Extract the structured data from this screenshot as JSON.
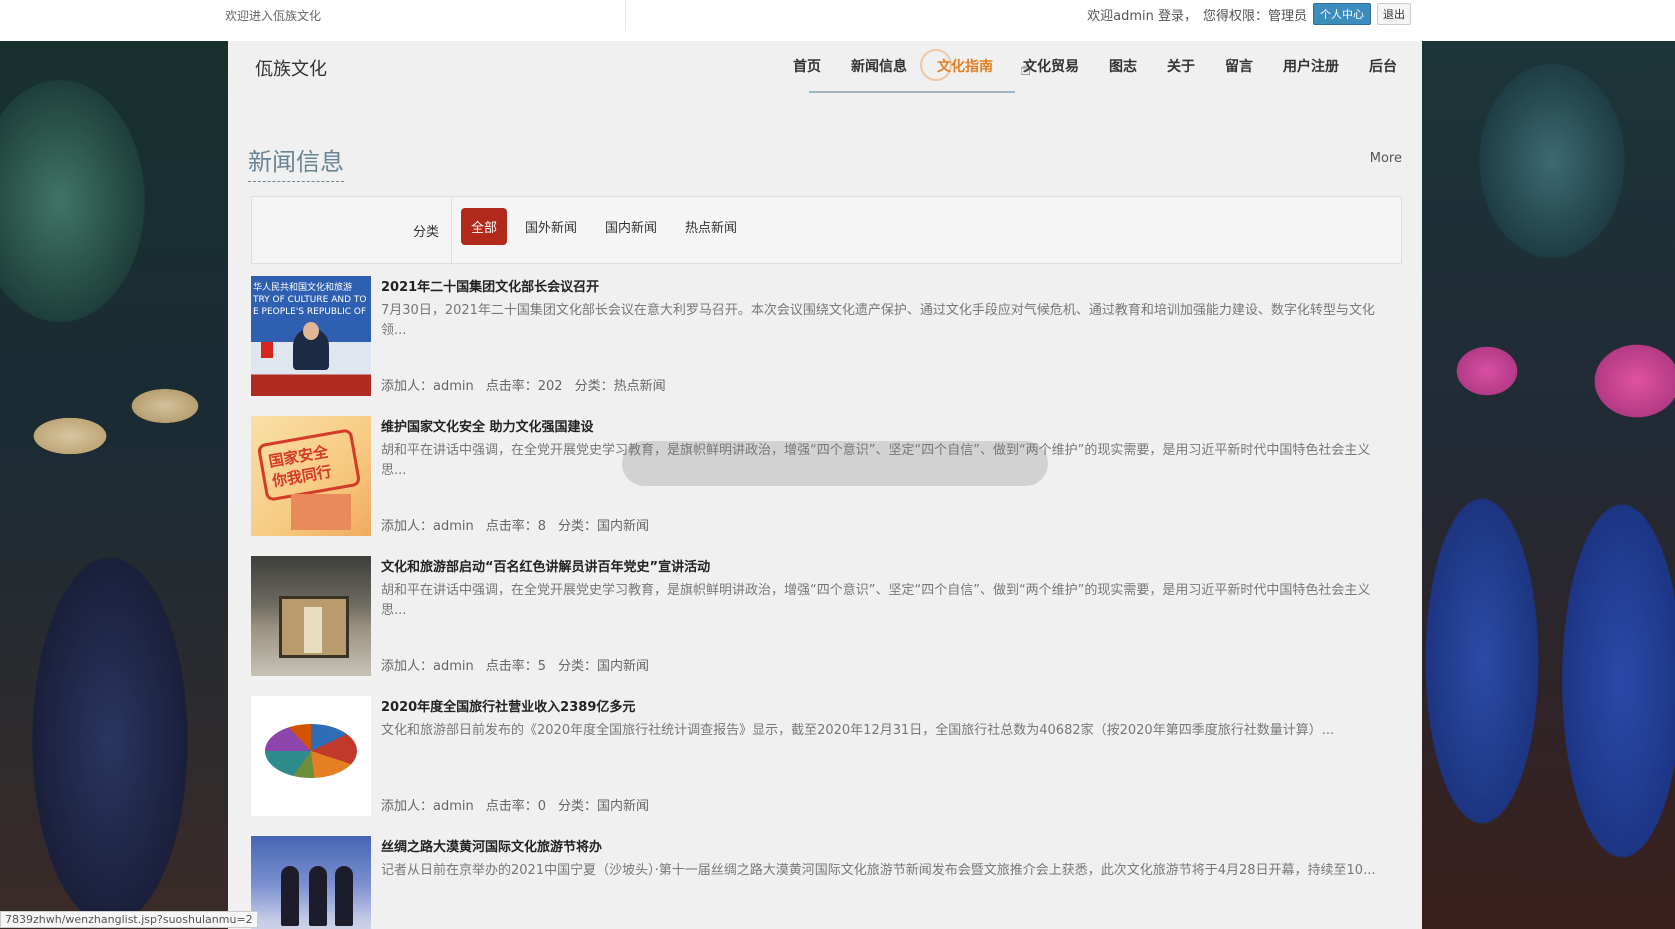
{
  "topbar": {
    "welcome": "欢迎进入佤族文化",
    "user_text": "欢迎admin 登录，",
    "role_text": "您得权限：管理员",
    "center_button": "个人中心",
    "logout_button": "退出"
  },
  "header": {
    "logo": "佤族文化",
    "nav": [
      {
        "label": "首页"
      },
      {
        "label": "新闻信息"
      },
      {
        "label": "文化指南"
      },
      {
        "label": "文化贸易"
      },
      {
        "label": "图志"
      },
      {
        "label": "关于"
      },
      {
        "label": "留言"
      },
      {
        "label": "用户注册"
      },
      {
        "label": "后台"
      }
    ],
    "active_color": "#e67e22"
  },
  "section": {
    "title": "新闻信息",
    "more": "More"
  },
  "filter": {
    "label": "分类",
    "options": [
      "全部",
      "国外新闻",
      "国内新闻",
      "热点新闻"
    ],
    "active_color": "#b0291b"
  },
  "news": [
    {
      "title": "2021年二十国集团文化部长会议召开",
      "summary": "7月30日，2021年二十国集团文化部长会议在意大利罗马召开。本次会议围绕文化遗产保护、通过文化手段应对气候危机、通过教育和培训加强能力建设、数字化转型与文化领...",
      "meta": {
        "author": "添加人：admin",
        "clicks": "点击率：202",
        "category": "分类：热点新闻"
      },
      "thumb_text": "华人民共和国文化和旅游\nTRY OF CULTURE AND TO\nE PEOPLE'S REPUBLIC OF"
    },
    {
      "title": "维护国家文化安全 助力文化强国建设",
      "summary": "胡和平在讲话中强调，在全党开展党史学习教育，是旗帜鲜明讲政治，增强“四个意识”、坚定“四个自信”、做到“两个维护”的现实需要，是用习近平新时代中国特色社会主义思...",
      "meta": {
        "author": "添加人：admin",
        "clicks": "点击率：8",
        "category": "分类：国内新闻"
      },
      "thumb_text": "国家安全\n你我同行"
    },
    {
      "title": "文化和旅游部启动“百名红色讲解员讲百年党史”宣讲活动",
      "summary": "胡和平在讲话中强调，在全党开展党史学习教育，是旗帜鲜明讲政治，增强“四个意识”、坚定“四个自信”、做到“两个维护”的现实需要，是用习近平新时代中国特色社会主义思...",
      "meta": {
        "author": "添加人：admin",
        "clicks": "点击率：5",
        "category": "分类：国内新闻"
      }
    },
    {
      "title": "2020年度全国旅行社营业收入2389亿多元",
      "summary": "文化和旅游部日前发布的《2020年度全国旅行社统计调查报告》显示，截至2020年12月31日，全国旅行社总数为40682家（按2020年第四季度旅行社数量计算）...",
      "meta": {
        "author": "添加人：admin",
        "clicks": "点击率：0",
        "category": "分类：国内新闻"
      }
    },
    {
      "title": "丝绸之路大漠黄河国际文化旅游节将办",
      "summary": "记者从日前在京举办的2021中国宁夏（沙坡头）·第十一届丝绸之路大漠黄河国际文化旅游节新闻发布会暨文旅推介会上获悉，此次文化旅游节将于4月28日开幕，持续至10...",
      "meta": {
        "author": "",
        "clicks": "",
        "category": ""
      }
    }
  ],
  "status_url": "7839zhwh/wenzhanglist.jsp?suoshulanmu=2"
}
